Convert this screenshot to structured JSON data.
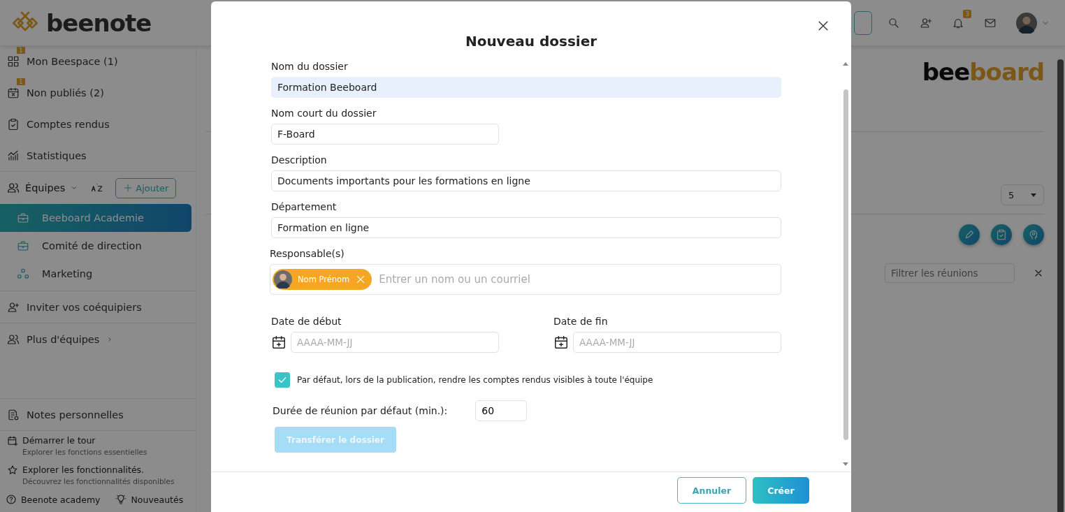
{
  "app": {
    "logo": "beenote"
  },
  "sidebar": {
    "nav": [
      {
        "label": "Mon Beespace (1)",
        "badge": "1"
      },
      {
        "label": "Non publiés (2)",
        "badge": "1"
      },
      {
        "label": "Comptes rendus"
      },
      {
        "label": "Statistiques"
      }
    ],
    "teams_header": {
      "label": "Équipes",
      "add_button": "Ajouter"
    },
    "teams": [
      {
        "name": "Beeboard Academie",
        "selected": true
      },
      {
        "name": "Comité de direction",
        "selected": false
      },
      {
        "name": "Marketing",
        "selected": false
      }
    ],
    "invite": "Inviter vos coéquipiers",
    "more_teams": "Plus d'équipes",
    "notes": "Notes personnelles",
    "help": [
      {
        "title": "Démarrer le tour",
        "subtitle": "Explorer les fonctions essentielles"
      },
      {
        "title": "Explorer les fonctionnalités.",
        "subtitle": "Découvrez les fonctionnalités disponibles"
      }
    ],
    "footer_links": [
      {
        "label": "Beenote academy"
      },
      {
        "label": "Nouveautés"
      }
    ]
  },
  "topbar": {
    "notification_count": "3"
  },
  "main": {
    "logo": {
      "dark": "bee",
      "accent": "board"
    },
    "page_size": "5",
    "filter_placeholder": "Filtrer les réunions"
  },
  "modal": {
    "title": "Nouveau dossier",
    "fields": [
      {
        "label": "Nom du dossier",
        "value": "Formation Beeboard",
        "highlighted": true,
        "short": false
      },
      {
        "label": "Nom court du dossier",
        "value": "F-Board",
        "highlighted": false,
        "short": true
      },
      {
        "label": "Description",
        "value": "Documents importants pour les formations en ligne",
        "highlighted": false,
        "short": false
      },
      {
        "label": "Département",
        "value": "Formation en ligne",
        "highlighted": false,
        "short": false
      }
    ],
    "responsables": {
      "label": "Responsable(s)",
      "chips": [
        {
          "name": "Nom Prénom"
        }
      ],
      "placeholder": "Entrer un nom ou un courriel"
    },
    "dates": [
      {
        "label": "Date de début",
        "placeholder": "AAAA-MM-JJ"
      },
      {
        "label": "Date de fin",
        "placeholder": "AAAA-MM-JJ"
      }
    ],
    "visible_default": {
      "label": "Par défaut, lors de la publication, rendre les comptes rendus visibles à toute l'équipe",
      "checked": true
    },
    "duration": {
      "label": "Durée de réunion par défaut (min.):",
      "value": "60"
    },
    "transfer_button": {
      "label": "Transférer le dossier",
      "disabled": true
    },
    "buttons": [
      {
        "label": "Annuler",
        "kind": "secondary"
      },
      {
        "label": "Créer",
        "kind": "primary"
      }
    ]
  }
}
